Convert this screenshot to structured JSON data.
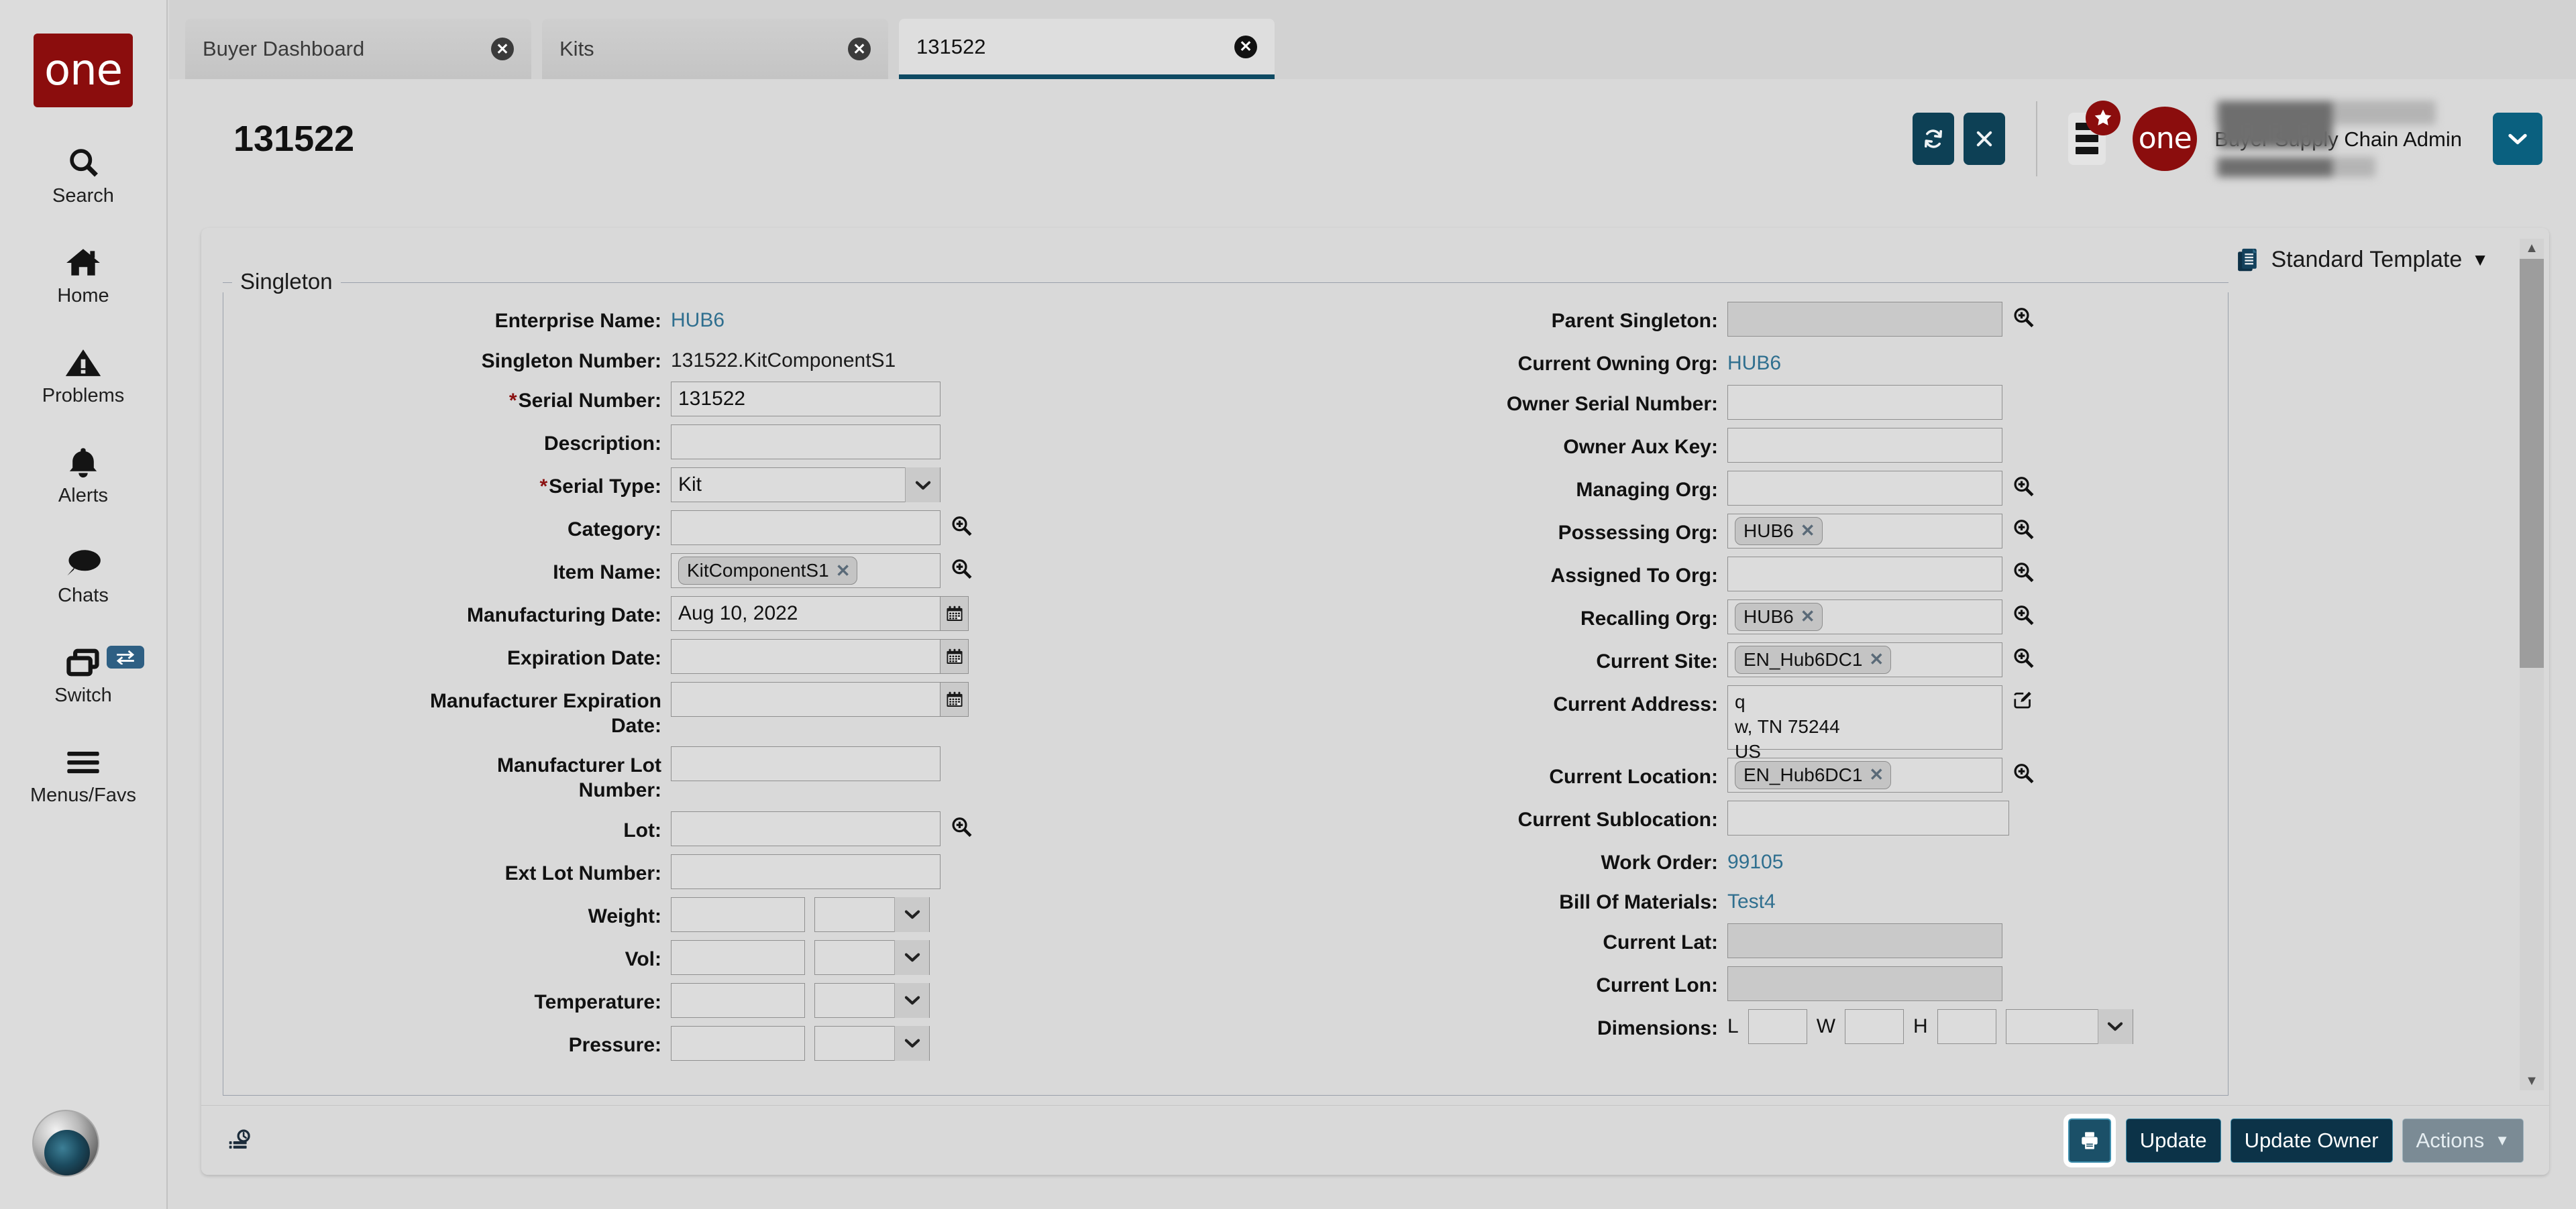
{
  "rail": {
    "logo_text": "one",
    "items": [
      {
        "label": "Search",
        "icon": "search-icon"
      },
      {
        "label": "Home",
        "icon": "home-icon"
      },
      {
        "label": "Problems",
        "icon": "warning-triangle-icon"
      },
      {
        "label": "Alerts",
        "icon": "bell-icon"
      },
      {
        "label": "Chats",
        "icon": "chat-bubble-icon"
      },
      {
        "label": "Switch",
        "icon": "switch-windows-icon"
      },
      {
        "label": "Menus/Favs",
        "icon": "hamburger-icon"
      }
    ],
    "switch_badge_icon": "swap-arrows-icon"
  },
  "tabs": [
    {
      "label": "Buyer Dashboard",
      "active": false,
      "close_label": "✕"
    },
    {
      "label": "Kits",
      "active": false,
      "close_label": "✕"
    },
    {
      "label": "131522",
      "active": true,
      "close_label": "✕"
    }
  ],
  "header": {
    "title": "131522",
    "refresh_icon": "refresh-icon",
    "close_icon": "close-x-icon",
    "menus_favs_icon": "menu-list-icon",
    "favorite_star_icon": "star-icon",
    "org_logo_text": "one",
    "user_name": "████████ ████████",
    "user_role": "Buyer Supply Chain Admin",
    "user_email": "██████████",
    "user_caret_icon": "chevron-down-icon"
  },
  "card": {
    "template_icon": "documents-icon",
    "template_label": "Standard Template",
    "template_caret": "▼",
    "fieldset_legend": "Singleton"
  },
  "form": {
    "left": [
      {
        "name": "enterprise-name",
        "label": "Enterprise Name:",
        "kind": "link",
        "value": "HUB6"
      },
      {
        "name": "singleton-number",
        "label": "Singleton Number:",
        "kind": "text",
        "value": "131522.KitComponentS1"
      },
      {
        "name": "serial-number",
        "label": "Serial Number:",
        "required": true,
        "kind": "input",
        "value": "131522"
      },
      {
        "name": "description",
        "label": "Description:",
        "kind": "input",
        "value": ""
      },
      {
        "name": "serial-type",
        "label": "Serial Type:",
        "required": true,
        "kind": "select",
        "value": "Kit"
      },
      {
        "name": "category",
        "label": "Category:",
        "kind": "input",
        "value": "",
        "magnifier": true
      },
      {
        "name": "item-name",
        "label": "Item Name:",
        "kind": "chip-input",
        "chip": "KitComponentS1",
        "magnifier": true
      },
      {
        "name": "manufacturing-date",
        "label": "Manufacturing Date:",
        "kind": "date",
        "value": "Aug 10, 2022"
      },
      {
        "name": "expiration-date",
        "label": "Expiration Date:",
        "kind": "date",
        "value": ""
      },
      {
        "name": "manufacturer-expiration-date",
        "label": "Manufacturer Expiration\nDate:",
        "kind": "date",
        "value": ""
      },
      {
        "name": "manufacturer-lot-number",
        "label": "Manufacturer Lot\nNumber:",
        "kind": "input",
        "value": ""
      },
      {
        "name": "lot",
        "label": "Lot:",
        "kind": "input",
        "value": "",
        "magnifier": true
      },
      {
        "name": "ext-lot-number",
        "label": "Ext Lot Number:",
        "kind": "input",
        "value": ""
      },
      {
        "name": "weight",
        "label": "Weight:",
        "kind": "value-unit",
        "value": "",
        "unit": ""
      },
      {
        "name": "vol",
        "label": "Vol:",
        "kind": "value-unit",
        "value": "",
        "unit": ""
      },
      {
        "name": "temperature",
        "label": "Temperature:",
        "kind": "value-unit",
        "value": "",
        "unit": ""
      },
      {
        "name": "pressure",
        "label": "Pressure:",
        "kind": "value-unit",
        "value": "",
        "unit": ""
      }
    ],
    "right": [
      {
        "name": "parent-singleton",
        "label": "Parent Singleton:",
        "kind": "input",
        "value": "",
        "magnifier": true
      },
      {
        "name": "current-owning-org",
        "label": "Current Owning Org:",
        "kind": "link",
        "value": "HUB6"
      },
      {
        "name": "owner-serial-number",
        "label": "Owner Serial Number:",
        "kind": "input",
        "value": ""
      },
      {
        "name": "owner-aux-key",
        "label": "Owner Aux Key:",
        "kind": "input",
        "value": ""
      },
      {
        "name": "managing-org",
        "label": "Managing Org:",
        "kind": "input",
        "value": "",
        "magnifier": true
      },
      {
        "name": "possessing-org",
        "label": "Possessing Org:",
        "kind": "chip-input",
        "chip": "HUB6",
        "magnifier": true
      },
      {
        "name": "assigned-to-org",
        "label": "Assigned To Org:",
        "kind": "input",
        "value": "",
        "magnifier": true
      },
      {
        "name": "recalling-org",
        "label": "Recalling Org:",
        "kind": "chip-input",
        "chip": "HUB6",
        "magnifier": true
      },
      {
        "name": "current-site",
        "label": "Current Site:",
        "kind": "chip-input",
        "chip": "EN_Hub6DC1",
        "magnifier": true
      },
      {
        "name": "current-address",
        "label": "Current Address:",
        "kind": "textarea",
        "value": "q\nw, TN 75244\nUS",
        "pencil": true
      },
      {
        "name": "current-location",
        "label": "Current Location:",
        "kind": "chip-input",
        "chip": "EN_Hub6DC1",
        "magnifier": true
      },
      {
        "name": "current-sublocation",
        "label": "Current Sublocation:",
        "kind": "input-wide",
        "value": ""
      },
      {
        "name": "work-order",
        "label": "Work Order:",
        "kind": "link",
        "value": "99105"
      },
      {
        "name": "bill-of-materials",
        "label": "Bill Of Materials:",
        "kind": "link",
        "value": "Test4"
      },
      {
        "name": "current-lat",
        "label": "Current Lat:",
        "kind": "input-readonly",
        "value": ""
      },
      {
        "name": "current-lon",
        "label": "Current Lon:",
        "kind": "input-readonly",
        "value": ""
      },
      {
        "name": "dimensions",
        "label": "Dimensions:",
        "kind": "dimensions",
        "l_label": "L",
        "w_label": "W",
        "h_label": "H",
        "l": "",
        "w": "",
        "h": "",
        "unit": ""
      }
    ]
  },
  "footer": {
    "audit_icon": "audit-trail-icon",
    "print_icon": "printer-icon",
    "update_label": "Update",
    "update_owner_label": "Update Owner",
    "actions_label": "Actions",
    "actions_caret": "▼"
  },
  "scrollbar": {
    "up_arrow": "▲",
    "down_arrow": "▼"
  },
  "colors": {
    "brand_red": "#8b0d0d",
    "teal_dark": "#0d4055",
    "teal_mid": "#0a607f",
    "primary_btn": "#0c3348",
    "link": "#2f6f8f",
    "required_star": "#8b1111",
    "active_tab_underline": "#0e4a63",
    "page_bg": "#d9d9d9"
  }
}
